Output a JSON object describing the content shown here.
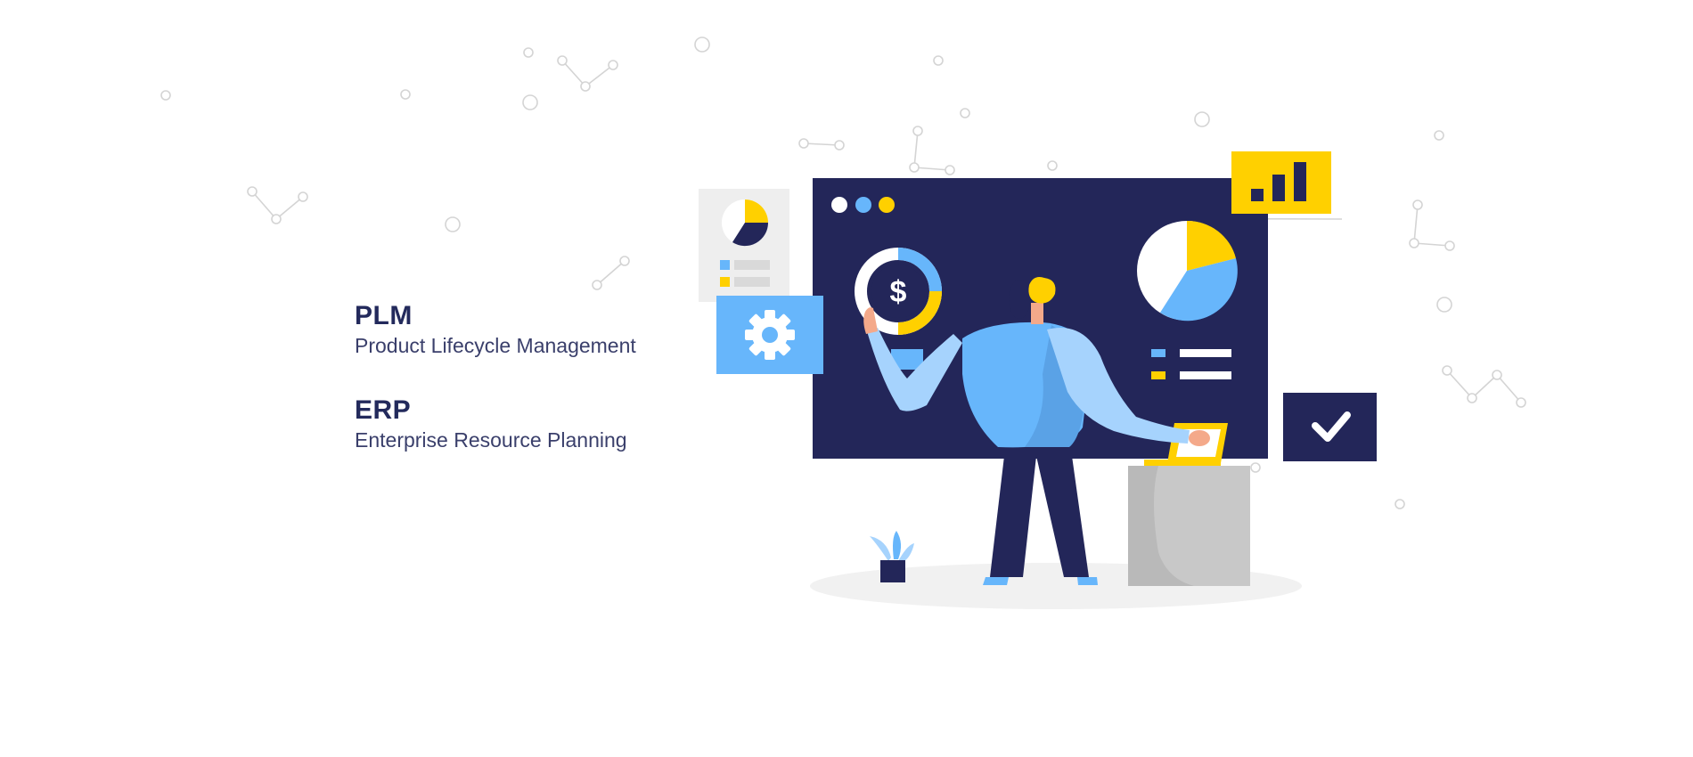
{
  "items": [
    {
      "acronym": "PLM",
      "name": "Product Lifecycle Management"
    },
    {
      "acronym": "ERP",
      "name": "Enterprise Resource Planning"
    }
  ],
  "illustration": {
    "coin_symbol": "$",
    "colors": {
      "navy": "#232659",
      "blue": "#67b6fb",
      "light_blue": "#a6d3fd",
      "yellow": "#ffd000",
      "gray": "#c8c8c8",
      "skin": "#f4a98a"
    },
    "icons": [
      "gear-icon",
      "bar-chart-icon",
      "checkmark-icon",
      "pie-chart-icon",
      "dollar-coin-icon",
      "plant-icon"
    ]
  }
}
